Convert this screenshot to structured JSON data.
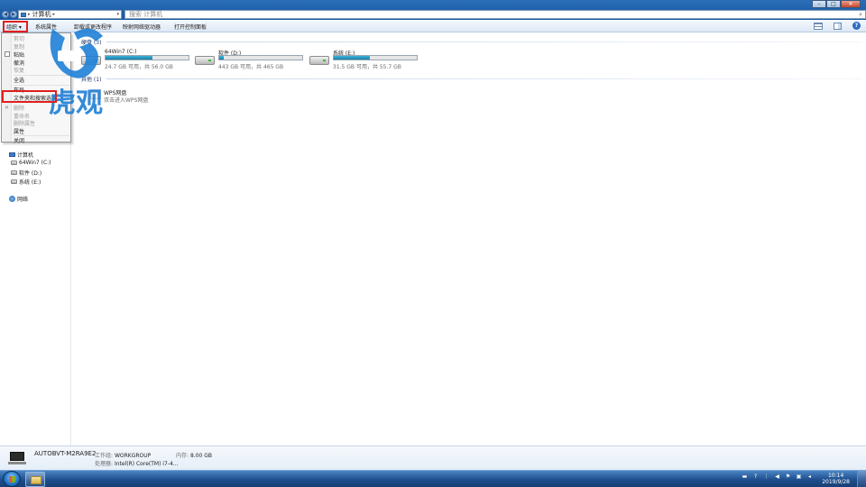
{
  "address": {
    "crumb": "计算机",
    "search_placeholder": "搜索 计算机"
  },
  "toolbar": {
    "organize": "组织 ▾",
    "system_properties": "系统属性",
    "uninstall": "卸载或更改程序",
    "map_drive": "映射网络驱动器",
    "control_panel": "打开控制面板"
  },
  "menu": {
    "items": [
      "剪切",
      "复制",
      "粘贴",
      "撤消",
      "恢复",
      "全选",
      "布局",
      "文件夹和搜索选项",
      "删除",
      "重命名",
      "删除属性",
      "属性",
      "关闭"
    ]
  },
  "nav": {
    "computer": "计算机",
    "drives": [
      "64Win7 (C:)",
      "软件 (D:)",
      "系统 (E:)"
    ],
    "network": "网络"
  },
  "content": {
    "group_hard_disks": "硬盘 (3)",
    "group_other": "其他 (1)",
    "drives": [
      {
        "name": "64Win7 (C:)",
        "info": "24.7 GB 可用，共 56.0 GB",
        "used_pct": 56
      },
      {
        "name": "软件 (D:)",
        "info": "443 GB 可用，共 465 GB",
        "used_pct": 5
      },
      {
        "name": "系统 (E:)",
        "info": "31.5 GB 可用，共 55.7 GB",
        "used_pct": 43
      }
    ],
    "wps": {
      "name": "WPS网盘",
      "desc": "双击进入WPS网盘"
    }
  },
  "details": {
    "pc_name": "AUTOBVT-M2RA9E2",
    "workgroup_label": "工作组:",
    "workgroup": "WORKGROUP",
    "memory_label": "内存:",
    "memory": "8.00 GB",
    "cpu_label": "处理器:",
    "cpu": "Intel(R) Core(TM) i7-4..."
  },
  "watermark": {
    "text": "虎观"
  },
  "taskbar": {
    "time": "10:14",
    "date": "2019/9/28"
  },
  "colors": {
    "highlight": "#e01f1f",
    "accent": "#1f5fa8",
    "drive_fill": "#1a7fa6"
  }
}
